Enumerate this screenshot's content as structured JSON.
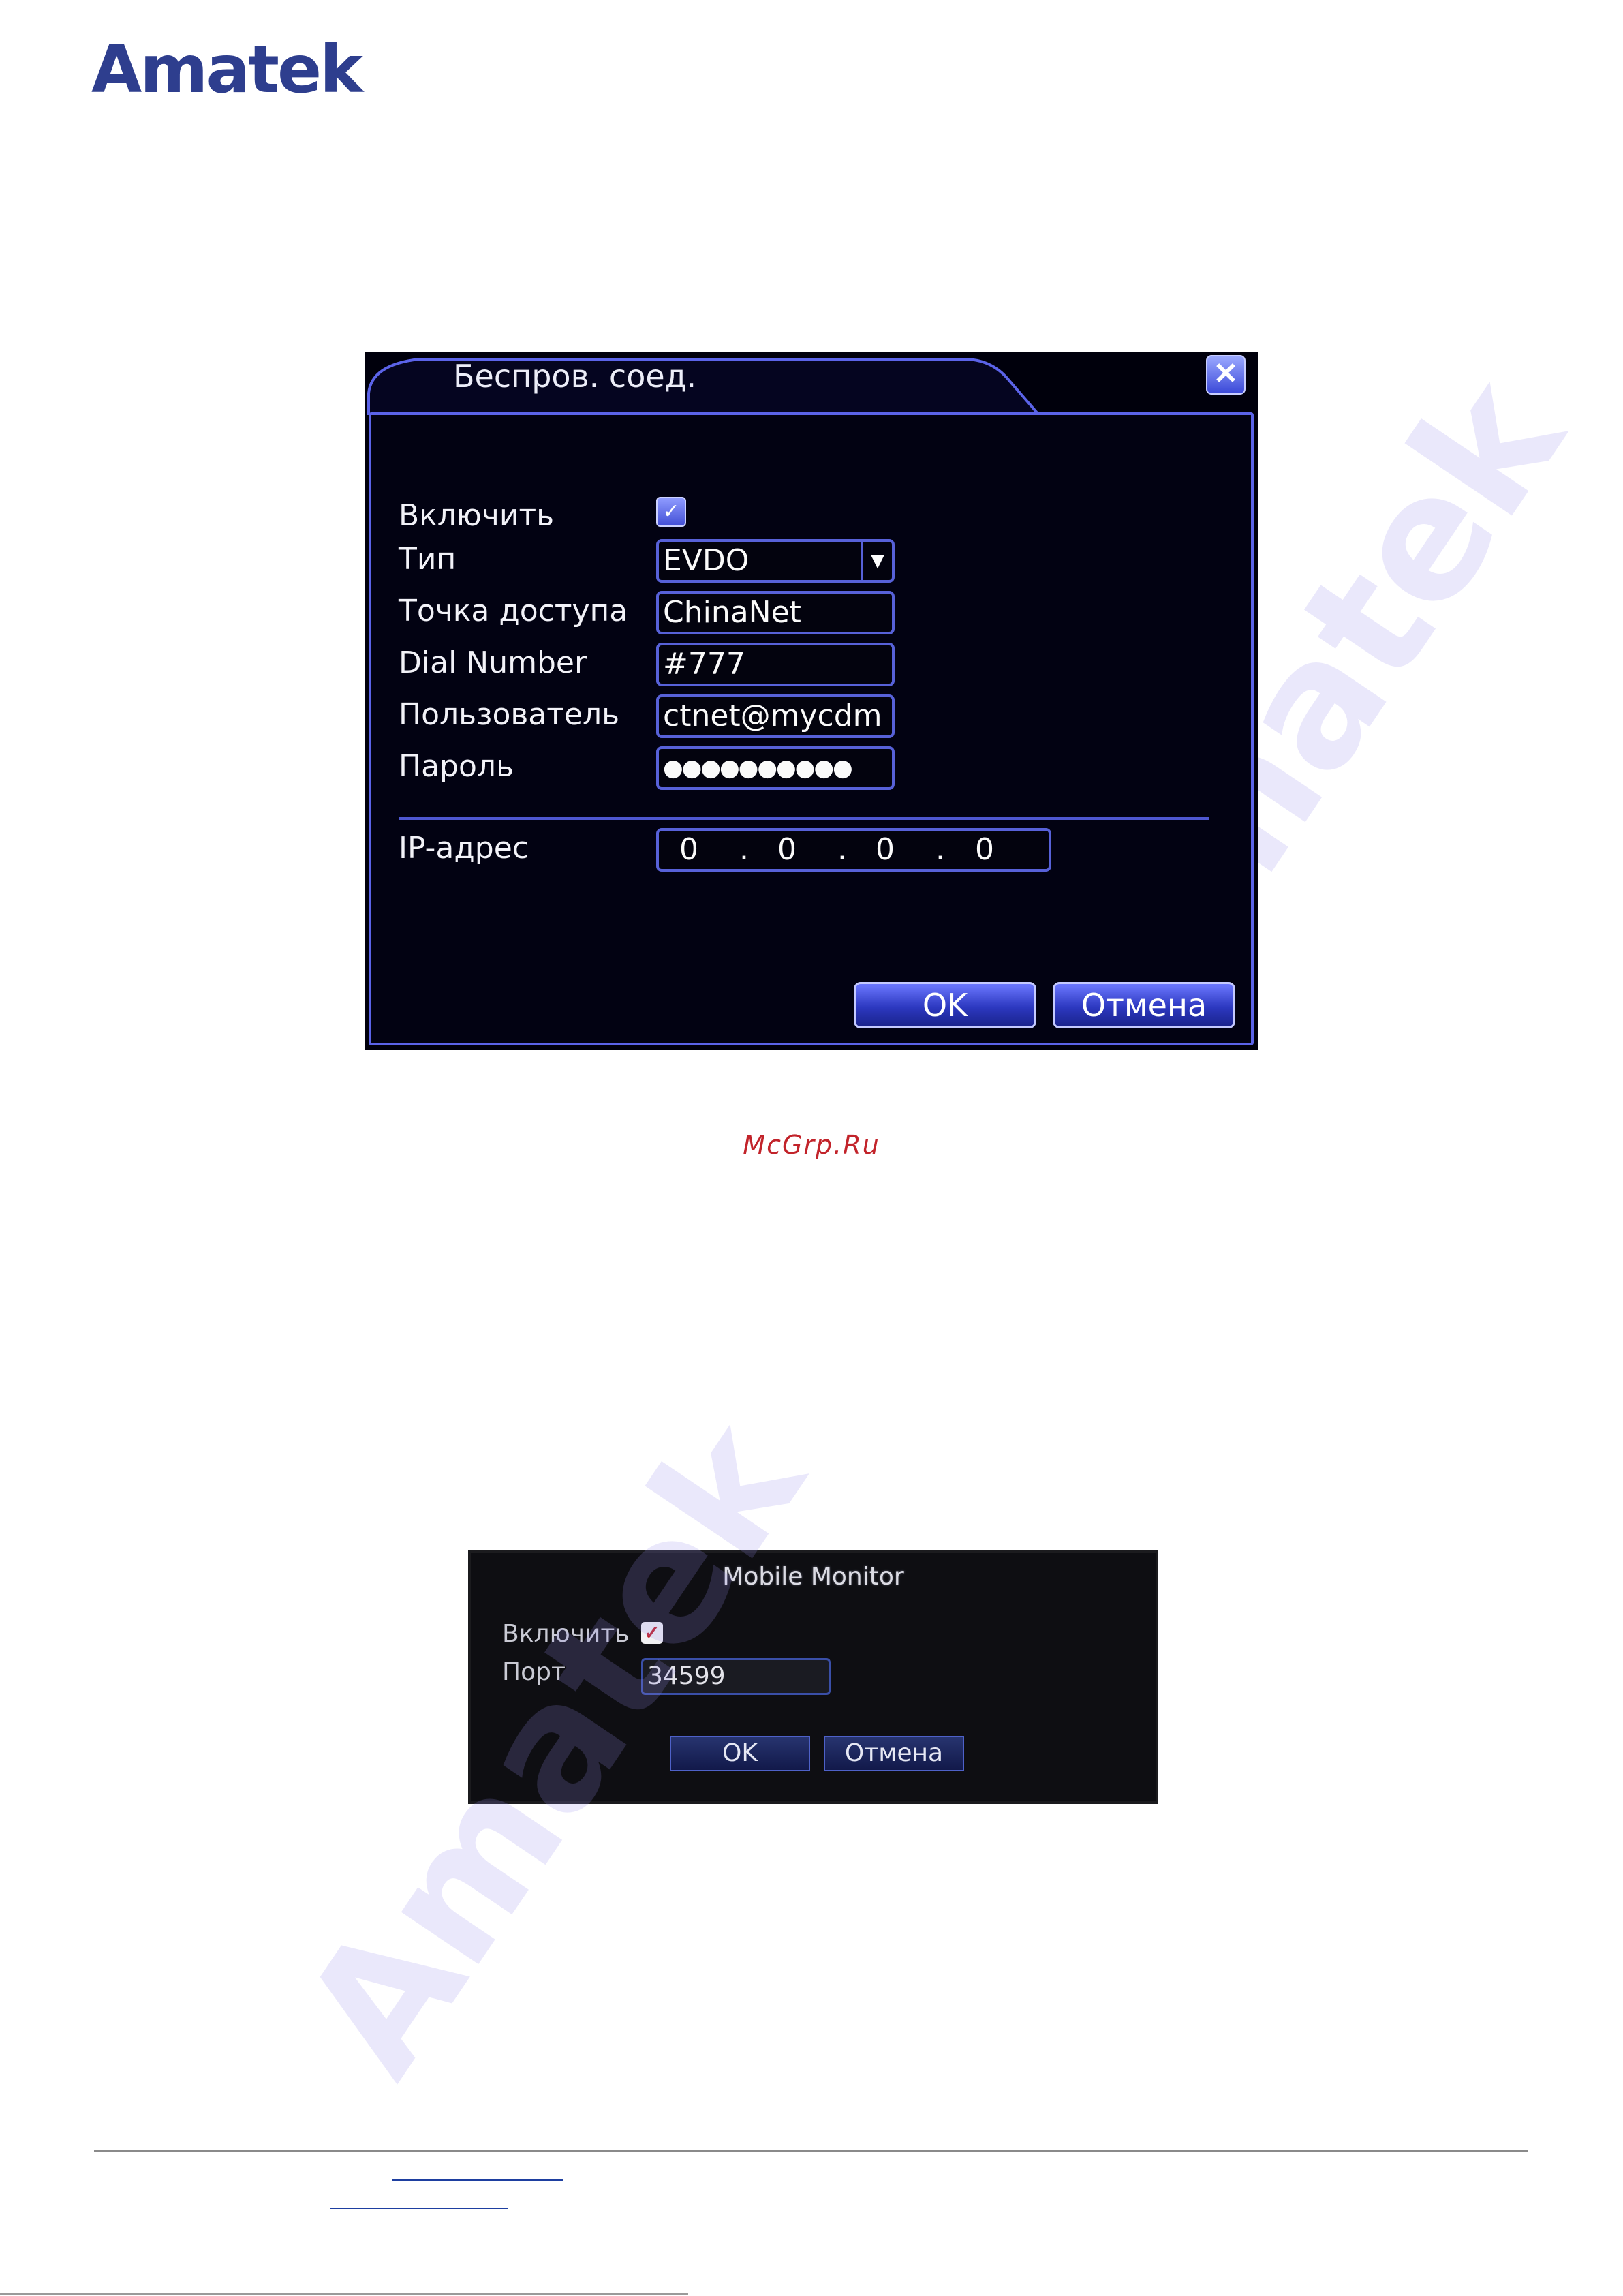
{
  "logo": "Amatek",
  "watermark": "Amatek",
  "wireless_dialog": {
    "title": "Беспров. соед.",
    "close_icon": "close-icon",
    "enable_label": "Включить",
    "enabled": true,
    "type_label": "Тип",
    "type_value": "EVDO",
    "ap_label": "Точка доступа",
    "ap_value": "ChinaNet",
    "dial_label": "Dial Number",
    "dial_value": "#777",
    "user_label": "Пользователь",
    "user_value": "ctnet@mycdm",
    "password_label": "Пароль",
    "password_value": "●●●●●●●●●●",
    "ip_label": "IP-адрес",
    "ip_octets": [
      "0",
      "0",
      "0",
      "0"
    ],
    "ok_label": "OK",
    "cancel_label": "Отмена"
  },
  "caption": "McGrp.Ru",
  "mobile_dialog": {
    "title": "Mobile Monitor",
    "enable_label": "Включить",
    "enabled": true,
    "port_label": "Порт",
    "port_value": "34599",
    "ok_label": "OK",
    "cancel_label": "Отмена"
  }
}
